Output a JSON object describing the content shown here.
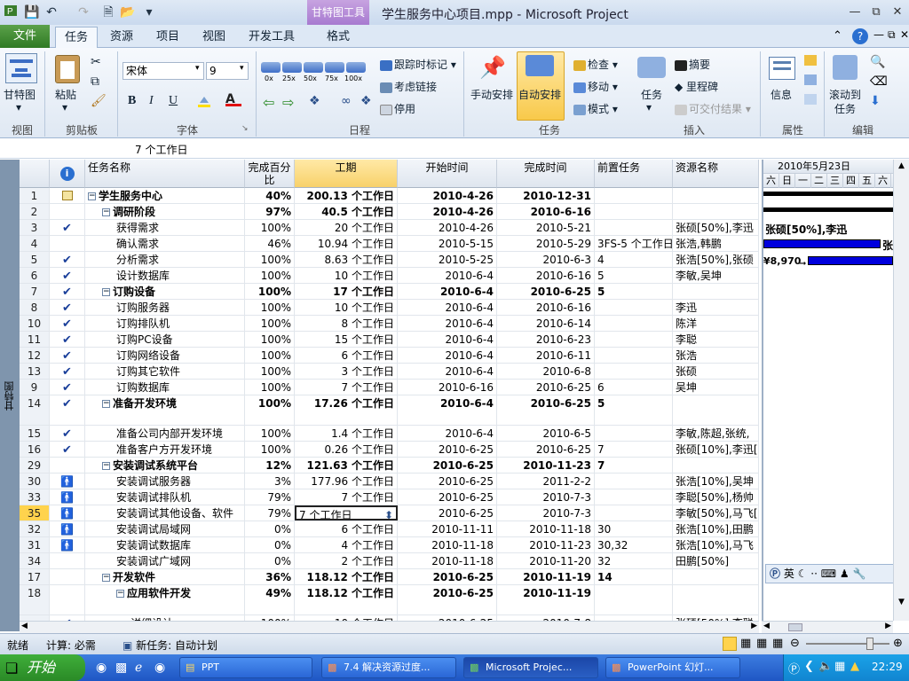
{
  "window": {
    "title": "学生服务中心项目.mpp - Microsoft Project",
    "context_tab": "甘特图工具",
    "context_subtab": "格式"
  },
  "tabs": [
    "文件",
    "任务",
    "资源",
    "项目",
    "视图",
    "开发工具"
  ],
  "ribbon": {
    "view_group": {
      "label": "视图",
      "button": "甘特图"
    },
    "clipboard": {
      "label": "剪贴板",
      "paste": "粘贴"
    },
    "font": {
      "label": "字体",
      "font_name": "宋体",
      "font_size": "9",
      "bold": "B",
      "italic": "I",
      "underline": "U"
    },
    "schedule": {
      "label": "日程",
      "pct_labels": [
        "0x",
        "25x",
        "50x",
        "75x",
        "100x"
      ],
      "track": "跟踪时标记",
      "respect_links": "考虑链接",
      "inactivate": "停用"
    },
    "tasks": {
      "label": "任务",
      "manual": "手动安排",
      "auto": "自动安排",
      "inspect": "检查",
      "move": "移动",
      "mode": "模式",
      "task": "任务"
    },
    "insert": {
      "label": "插入",
      "summary": "摘要",
      "milestone": "里程碑",
      "deliverable": "可交付结果"
    },
    "properties": {
      "label": "属性",
      "info": "信息"
    },
    "editing": {
      "label": "编辑",
      "scroll": "滚动到",
      "scroll2": "任务"
    }
  },
  "formula_value": "7 个工作日",
  "sidebar_label": "甘特图",
  "columns": {
    "info": "i",
    "name": "任务名称",
    "pct": "完成百分比",
    "duration": "工期",
    "start": "开始时间",
    "finish": "完成时间",
    "pred": "前置任务",
    "res": "资源名称"
  },
  "rows": [
    {
      "id": "1",
      "ind": "note",
      "lvl": 0,
      "tog": "−",
      "name": "学生服务中心",
      "pct": "40%",
      "dur": "200.13 个工作日",
      "start": "2010-4-26",
      "finish": "2010-12-31",
      "pred": "",
      "res": "",
      "bold": true
    },
    {
      "id": "2",
      "ind": "",
      "lvl": 1,
      "tog": "−",
      "name": "调研阶段",
      "pct": "97%",
      "dur": "40.5 个工作日",
      "start": "2010-4-26",
      "finish": "2010-6-16",
      "pred": "",
      "res": "",
      "bold": true
    },
    {
      "id": "3",
      "ind": "check",
      "lvl": 2,
      "name": "获得需求",
      "pct": "100%",
      "dur": "20 个工作日",
      "start": "2010-4-26",
      "finish": "2010-5-21",
      "pred": "",
      "res": "张硕[50%],李迅"
    },
    {
      "id": "4",
      "ind": "",
      "lvl": 2,
      "name": "确认需求",
      "pct": "46%",
      "dur": "10.94 个工作日",
      "start": "2010-5-15",
      "finish": "2010-5-29",
      "pred": "3FS-5 个工作日",
      "res": "张浩,韩鹏"
    },
    {
      "id": "5",
      "ind": "check",
      "lvl": 2,
      "name": "分析需求",
      "pct": "100%",
      "dur": "8.63 个工作日",
      "start": "2010-5-25",
      "finish": "2010-6-3",
      "pred": "4",
      "res": "张浩[50%],张硕"
    },
    {
      "id": "6",
      "ind": "check",
      "lvl": 2,
      "name": "设计数据库",
      "pct": "100%",
      "dur": "10 个工作日",
      "start": "2010-6-4",
      "finish": "2010-6-16",
      "pred": "5",
      "res": "李敏,吴坤"
    },
    {
      "id": "7",
      "ind": "check",
      "lvl": 1,
      "tog": "−",
      "name": "订购设备",
      "pct": "100%",
      "dur": "17 个工作日",
      "start": "2010-6-4",
      "finish": "2010-6-25",
      "pred": "5",
      "res": "",
      "bold": true
    },
    {
      "id": "8",
      "ind": "check",
      "lvl": 2,
      "name": "订购服务器",
      "pct": "100%",
      "dur": "10 个工作日",
      "start": "2010-6-4",
      "finish": "2010-6-16",
      "pred": "",
      "res": "李迅"
    },
    {
      "id": "10",
      "ind": "check",
      "lvl": 2,
      "name": "订购排队机",
      "pct": "100%",
      "dur": "8 个工作日",
      "start": "2010-6-4",
      "finish": "2010-6-14",
      "pred": "",
      "res": "陈洋"
    },
    {
      "id": "11",
      "ind": "check",
      "lvl": 2,
      "name": "订购PC设备",
      "pct": "100%",
      "dur": "15 个工作日",
      "start": "2010-6-4",
      "finish": "2010-6-23",
      "pred": "",
      "res": "李聪"
    },
    {
      "id": "12",
      "ind": "check",
      "lvl": 2,
      "name": "订购网络设备",
      "pct": "100%",
      "dur": "6 个工作日",
      "start": "2010-6-4",
      "finish": "2010-6-11",
      "pred": "",
      "res": "张浩"
    },
    {
      "id": "13",
      "ind": "check",
      "lvl": 2,
      "name": "订购其它软件",
      "pct": "100%",
      "dur": "3 个工作日",
      "start": "2010-6-4",
      "finish": "2010-6-8",
      "pred": "",
      "res": "张硕"
    },
    {
      "id": "9",
      "ind": "check",
      "lvl": 2,
      "name": "订购数据库",
      "pct": "100%",
      "dur": "7 个工作日",
      "start": "2010-6-16",
      "finish": "2010-6-25",
      "pred": "6",
      "res": "吴坤"
    },
    {
      "id": "14",
      "ind": "check",
      "lvl": 1,
      "tog": "−",
      "name": "准备开发环境",
      "pct": "100%",
      "dur": "17.26 个工作日",
      "start": "2010-6-4",
      "finish": "2010-6-25",
      "pred": "5",
      "res": "",
      "bold": true,
      "tall": true
    },
    {
      "id": "15",
      "ind": "check",
      "lvl": 2,
      "name": "准备公司内部开发环境",
      "pct": "100%",
      "dur": "1.4 个工作日",
      "start": "2010-6-4",
      "finish": "2010-6-5",
      "pred": "",
      "res": "李敏,陈超,张统,"
    },
    {
      "id": "16",
      "ind": "check",
      "lvl": 2,
      "name": "准备客户方开发环境",
      "pct": "100%",
      "dur": "0.26 个工作日",
      "start": "2010-6-25",
      "finish": "2010-6-25",
      "pred": "7",
      "res": "张硕[10%],李迅[2"
    },
    {
      "id": "29",
      "ind": "",
      "lvl": 1,
      "tog": "−",
      "name": "安装调试系统平台",
      "pct": "12%",
      "dur": "121.63 个工作日",
      "start": "2010-6-25",
      "finish": "2010-11-23",
      "pred": "7",
      "res": "",
      "bold": true
    },
    {
      "id": "30",
      "ind": "man",
      "lvl": 2,
      "name": "安装调试服务器",
      "pct": "3%",
      "dur": "177.96 个工作日",
      "start": "2010-6-25",
      "finish": "2011-2-2",
      "pred": "",
      "res": "张浩[10%],吴坤"
    },
    {
      "id": "33",
      "ind": "man",
      "lvl": 2,
      "name": "安装调试排队机",
      "pct": "79%",
      "dur": "7 个工作日",
      "start": "2010-6-25",
      "finish": "2010-7-3",
      "pred": "",
      "res": "李聪[50%],杨帅"
    },
    {
      "id": "35",
      "ind": "man",
      "lvl": 2,
      "name": "安装调试其他设备、软件",
      "pct": "79%",
      "dur": "7 个工作日",
      "start": "2010-6-25",
      "finish": "2010-7-3",
      "pred": "",
      "res": "李敏[50%],马飞[5",
      "selected": true
    },
    {
      "id": "32",
      "ind": "man",
      "lvl": 2,
      "name": "安装调试局域网",
      "pct": "0%",
      "dur": "6 个工作日",
      "start": "2010-11-11",
      "finish": "2010-11-18",
      "pred": "30",
      "res": "张浩[10%],田鹏"
    },
    {
      "id": "31",
      "ind": "man",
      "lvl": 2,
      "name": "安装调试数据库",
      "pct": "0%",
      "dur": "4 个工作日",
      "start": "2010-11-18",
      "finish": "2010-11-23",
      "pred": "30,32",
      "res": "张浩[10%],马飞"
    },
    {
      "id": "34",
      "ind": "",
      "lvl": 2,
      "name": "安装调试广域网",
      "pct": "0%",
      "dur": "2 个工作日",
      "start": "2010-11-18",
      "finish": "2010-11-20",
      "pred": "32",
      "res": "田鹏[50%]"
    },
    {
      "id": "17",
      "ind": "",
      "lvl": 1,
      "tog": "−",
      "name": "开发软件",
      "pct": "36%",
      "dur": "118.12 个工作日",
      "start": "2010-6-25",
      "finish": "2010-11-19",
      "pred": "14",
      "res": "",
      "bold": true
    },
    {
      "id": "18",
      "ind": "",
      "lvl": 2,
      "tog": "−",
      "name": "应用软件开发",
      "pct": "49%",
      "dur": "118.12 个工作日",
      "start": "2010-6-25",
      "finish": "2010-11-19",
      "pred": "",
      "res": "",
      "bold": true,
      "tall": true
    },
    {
      "id": "",
      "ind": "check",
      "lvl": 3,
      "name": "详细设计",
      "pct": "100%",
      "dur": "10 个工作日",
      "start": "2010-6-25",
      "finish": "2010-7-8",
      "pred": "",
      "res": "张硕[50%],李聪,阝"
    }
  ],
  "gantt": {
    "period": "2010年5月23日",
    "days": [
      "六",
      "日",
      "一",
      "二",
      "三",
      "四",
      "五",
      "六"
    ],
    "label1": "张硕[50%],李迅",
    "label3": "¥8,970",
    "label2_tail": "张"
  },
  "ime": {
    "lang": "英"
  },
  "status": {
    "ready": "就绪",
    "calc": "计算: 必需",
    "newtask": "新任务: 自动计划"
  },
  "taskbar": {
    "start": "开始",
    "items": [
      "PPT",
      "7.4 解决资源过度...",
      "Microsoft Projec...",
      "PowerPoint 幻灯..."
    ],
    "clock": "22:29"
  },
  "colors": {
    "accent": "#2f7a24",
    "selection": "#ffd34d",
    "bar": "#0000dd"
  }
}
